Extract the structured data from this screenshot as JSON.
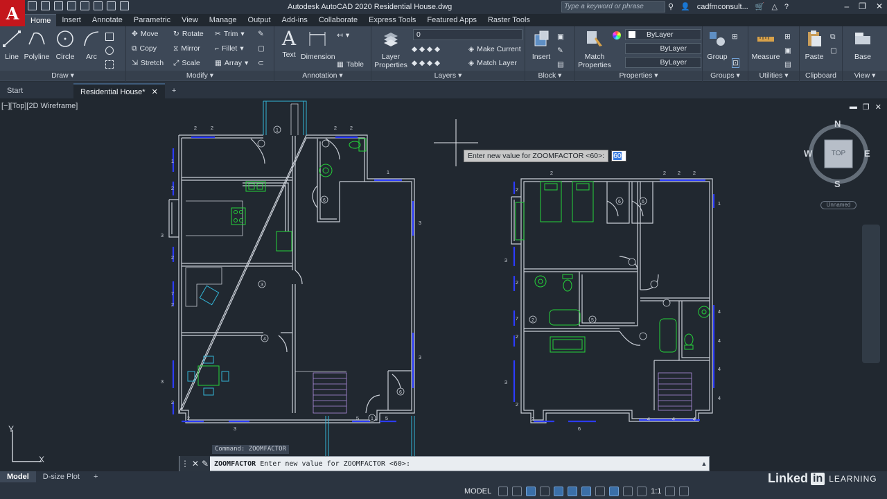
{
  "app": {
    "logo_letter": "A",
    "title": "Autodesk AutoCAD 2020    Residential House.dwg",
    "search_placeholder": "Type a keyword or phrase",
    "user": "cadfmconsult...",
    "help": "?"
  },
  "ribbon_tabs": [
    "Home",
    "Insert",
    "Annotate",
    "Parametric",
    "View",
    "Manage",
    "Output",
    "Add-ins",
    "Collaborate",
    "Express Tools",
    "Featured Apps",
    "Raster Tools"
  ],
  "ribbon": {
    "draw": {
      "title": "Draw",
      "line": "Line",
      "polyline": "Polyline",
      "circle": "Circle",
      "arc": "Arc"
    },
    "modify": {
      "title": "Modify",
      "move": "Move",
      "rotate": "Rotate",
      "trim": "Trim",
      "copy": "Copy",
      "mirror": "Mirror",
      "fillet": "Fillet",
      "stretch": "Stretch",
      "scale": "Scale",
      "array": "Array"
    },
    "annotation": {
      "title": "Annotation",
      "text": "Text",
      "dimension": "Dimension",
      "table": "Table"
    },
    "layers": {
      "title": "Layers",
      "layer_properties": "Layer Properties",
      "layer_current": "0",
      "make_current": "Make Current",
      "match_layer": "Match Layer"
    },
    "block": {
      "title": "Block",
      "insert": "Insert"
    },
    "properties": {
      "title": "Properties",
      "match_properties": "Match Properties",
      "color": "ByLayer",
      "linetype": "ByLayer",
      "lineweight": "ByLayer"
    },
    "groups": {
      "title": "Groups",
      "group": "Group"
    },
    "utilities": {
      "title": "Utilities",
      "measure": "Measure"
    },
    "clipboard": {
      "title": "Clipboard",
      "paste": "Paste"
    },
    "view": {
      "title": "View",
      "base": "Base"
    }
  },
  "doc_tabs": {
    "start": "Start",
    "active": "Residential House*",
    "close": "✕",
    "add": "+"
  },
  "viewport": {
    "label": "[−][Top][2D Wireframe]",
    "controls": [
      "▬",
      "❐",
      "✕"
    ]
  },
  "viewcube": {
    "n": "N",
    "s": "S",
    "e": "E",
    "w": "W",
    "face": "TOP",
    "unnamed": "Unnamed"
  },
  "tooltip": {
    "prompt": "Enter new value for ZOOMFACTOR <60>:",
    "value": "60"
  },
  "command": {
    "history": "Command: ZOOMFACTOR",
    "current_cmd": "ZOOMFACTOR",
    "current_prompt": " Enter new value for ZOOMFACTOR <60>:",
    "close_icon": "✕",
    "wrench_icon": "🔧"
  },
  "ucs": {
    "x": "X",
    "y": "Y"
  },
  "layout_tabs": [
    "Model",
    "D-size Plot",
    "+"
  ],
  "status": {
    "model": "MODEL",
    "scale": "1:1"
  },
  "brand": {
    "name": "Linked",
    "in": "in",
    "learning": "LEARNING"
  },
  "floorplan_left": {
    "tags": [
      "1",
      "2",
      "2",
      "2",
      "2",
      "1",
      "1",
      "1",
      "1",
      "3",
      "2",
      "2",
      "2",
      "3",
      "3",
      "4",
      "5",
      "5",
      "6",
      "6",
      "6",
      "7",
      "3",
      "2",
      "2",
      "1",
      "2",
      "3"
    ]
  },
  "colors": {
    "wall": "#c9ced6",
    "door": "#c9ced6",
    "fixture_green": "#25d43a",
    "fixture_cyan": "#33b6d8",
    "tag_blue": "#2c3cff",
    "stair": "#b08fe0",
    "accent_red": "#c4161c"
  }
}
